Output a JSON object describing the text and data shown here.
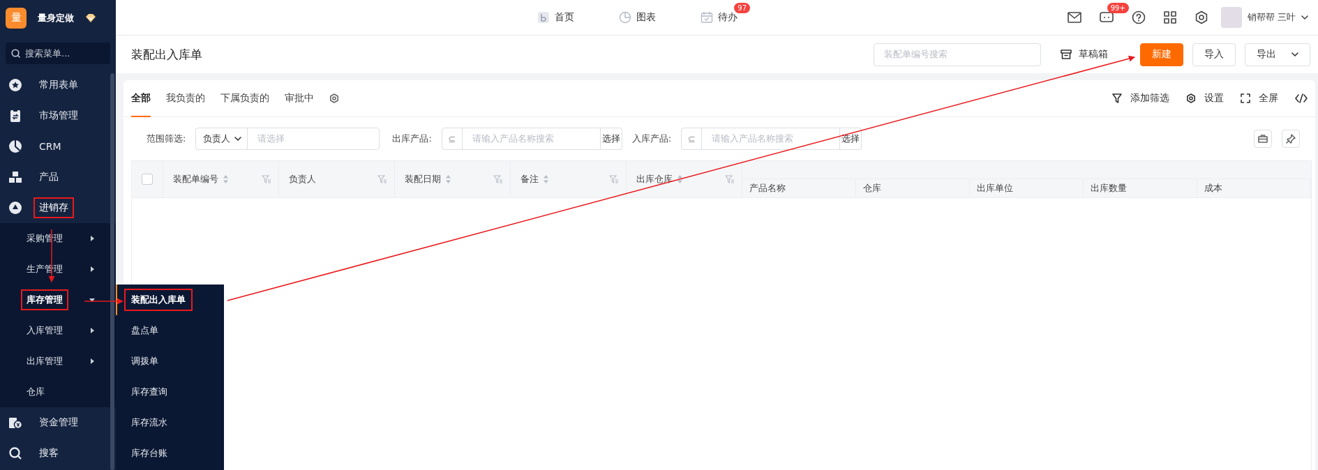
{
  "sidebar": {
    "logo": "量",
    "brand": "量身定做",
    "search_placeholder": "搜索菜单...",
    "items": [
      {
        "label": "常用表单",
        "highlighted": false
      },
      {
        "label": "市场管理",
        "highlighted": false
      },
      {
        "label": "CRM",
        "highlighted": false
      },
      {
        "label": "产品",
        "highlighted": false
      },
      {
        "label": "进销存",
        "expanded": true,
        "highlighted": true,
        "children": [
          {
            "label": "采购管理",
            "kind": "submenu",
            "expanded": false,
            "highlighted": false
          },
          {
            "label": "生产管理",
            "kind": "submenu",
            "expanded": false,
            "highlighted": false
          },
          {
            "label": "库存管理",
            "kind": "submenu",
            "expanded": true,
            "highlighted": true
          },
          {
            "label": "入库管理",
            "kind": "submenu",
            "expanded": false,
            "highlighted": false
          },
          {
            "label": "出库管理",
            "kind": "submenu",
            "expanded": false,
            "highlighted": false
          },
          {
            "label": "仓库",
            "kind": "link",
            "expanded": false,
            "highlighted": false
          }
        ]
      },
      {
        "label": "资金管理",
        "highlighted": false
      },
      {
        "label": "搜客",
        "highlighted": false
      }
    ]
  },
  "flyout": {
    "items": [
      {
        "label": "装配出入库单",
        "selected": true,
        "highlighted": true
      },
      {
        "label": "盘点单",
        "selected": false,
        "highlighted": false
      },
      {
        "label": "调拨单",
        "selected": false,
        "highlighted": false
      },
      {
        "label": "库存查询",
        "selected": false,
        "highlighted": false
      },
      {
        "label": "库存流水",
        "selected": false,
        "highlighted": false
      },
      {
        "label": "库存台账",
        "selected": false,
        "highlighted": false
      }
    ]
  },
  "topbar": {
    "nav": [
      {
        "label": "首页"
      },
      {
        "label": "图表"
      },
      {
        "label": "待办",
        "badge": "97"
      }
    ],
    "message_badge": "99+",
    "user": "销帮帮 三叶"
  },
  "page": {
    "title": "装配出入库单",
    "search_placeholder": "装配单编号搜索",
    "drafts": "草稿箱",
    "buttons": [
      {
        "label": "新建",
        "kind": "primary"
      },
      {
        "label": "导入",
        "kind": "default"
      },
      {
        "label": "导出",
        "kind": "dropdown"
      }
    ]
  },
  "tabs": [
    {
      "label": "全部",
      "selected": true
    },
    {
      "label": "我负责的",
      "selected": false
    },
    {
      "label": "下属负责的",
      "selected": false
    },
    {
      "label": "审批中",
      "selected": false
    }
  ],
  "toolbar": [
    "添加筛选",
    "设置",
    "全屏"
  ],
  "filters": {
    "scope_label": "范围筛选:",
    "scope_select": "负责人",
    "scope_placeholder": "请选择",
    "products": [
      {
        "label": "出库产品:",
        "prefix": "⊆",
        "placeholder": "请输入产品名称搜索",
        "button": "选择"
      },
      {
        "label": "入库产品:",
        "prefix": "⊆",
        "placeholder": "请输入产品名称搜索",
        "button": "选择"
      }
    ]
  },
  "table": {
    "select_all_checked": false,
    "columns": [
      {
        "label": "装配单编号",
        "sortable": true
      },
      {
        "label": "负责人",
        "sortable": false
      },
      {
        "label": "装配日期",
        "sortable": true
      },
      {
        "label": "备注",
        "sortable": true
      },
      {
        "label": "出库仓库",
        "sortable": true
      }
    ],
    "group_columns": [
      "产品名称",
      "仓库",
      "出库单位",
      "出库数量",
      "成本"
    ]
  }
}
